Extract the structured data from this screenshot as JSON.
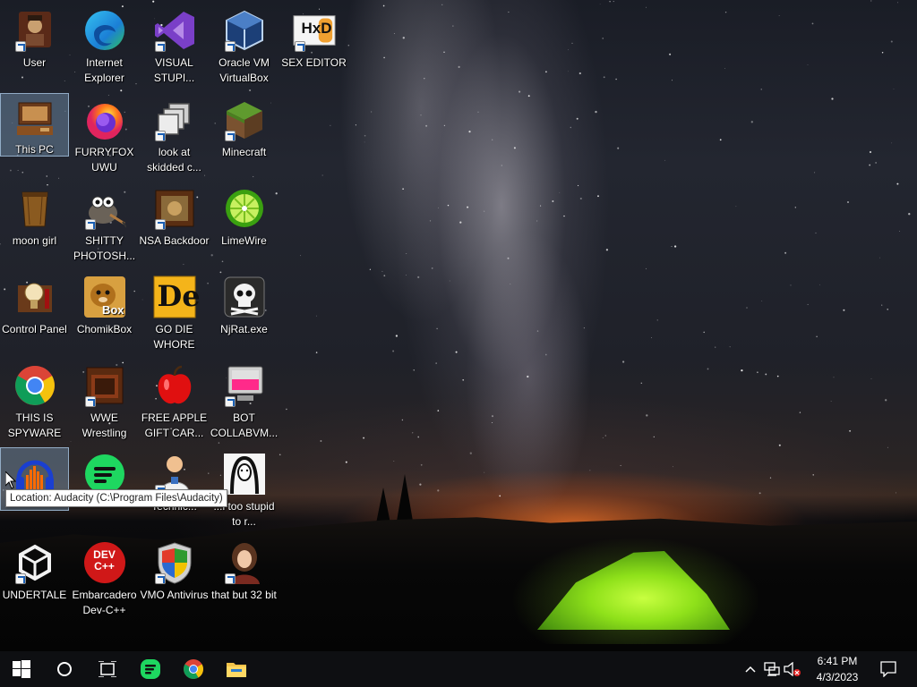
{
  "desktop": {
    "icons": [
      {
        "id": "user",
        "label": "User"
      },
      {
        "id": "internet-explorer",
        "label": "Internet Explorer"
      },
      {
        "id": "visual-studio",
        "label": "VISUAL STUPI..."
      },
      {
        "id": "virtualbox",
        "label": "Oracle VM VirtualBox"
      },
      {
        "id": "hex-editor",
        "label": "SEX EDITOR"
      },
      {
        "id": "this-pc",
        "label": "This PC"
      },
      {
        "id": "firefox",
        "label": "FURRYFOX UWU"
      },
      {
        "id": "look-at-skidded",
        "label": "look at skidded c..."
      },
      {
        "id": "minecraft",
        "label": "Minecraft"
      },
      {
        "id": "moon-girl",
        "label": "moon girl"
      },
      {
        "id": "gimp",
        "label": "SHITTY PHOTOSH..."
      },
      {
        "id": "nsa-backdoor",
        "label": "NSA Backdoor"
      },
      {
        "id": "limewire",
        "label": "LimeWire"
      },
      {
        "id": "control-panel",
        "label": "Control Panel"
      },
      {
        "id": "chomikbox",
        "label": "ChomikBox"
      },
      {
        "id": "go-die",
        "label": "GO DIE WHORE"
      },
      {
        "id": "njrat",
        "label": "NjRat.exe"
      },
      {
        "id": "chrome",
        "label": "THIS IS SPYWARE"
      },
      {
        "id": "wwe",
        "label": "WWE Wrestling"
      },
      {
        "id": "free-apple",
        "label": "FREE APPLE GIFT CAR..."
      },
      {
        "id": "bot-collabvm",
        "label": "BOT COLLABVM..."
      },
      {
        "id": "audacity",
        "label": ""
      },
      {
        "id": "spotify",
        "label": ""
      },
      {
        "id": "technic",
        "label": "Technic..."
      },
      {
        "id": "too-stupid",
        "label": "...l too stupid to r..."
      },
      {
        "id": "undertale",
        "label": "UNDERTALE"
      },
      {
        "id": "devcpp",
        "label": "Embarcadero Dev-C++"
      },
      {
        "id": "vmo-antivirus",
        "label": "VMO Antivirus"
      },
      {
        "id": "32bit",
        "label": "that but 32 bit"
      }
    ],
    "tooltip": "Location: Audacity (C:\\Program Files\\Audacity)",
    "devcpp_badge": "DEV C++",
    "chomik_badge": "Box",
    "de_badge": "De",
    "hxd_badge": "HxD"
  },
  "taskbar": {
    "time": "6:41 PM",
    "date": "4/3/2023"
  },
  "colors": {
    "taskbar_bg": "#0e0f12",
    "selection": "#7896b4"
  }
}
